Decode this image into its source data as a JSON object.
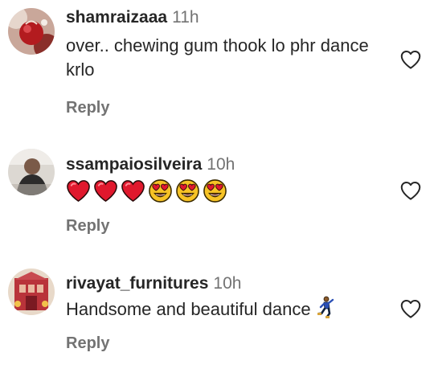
{
  "comments": [
    {
      "username": "shamraizaaa",
      "time": "11h",
      "text": "over.. chewing gum thook lo phr dance krlo",
      "reply_label": "Reply",
      "avatar_icon": "profile-photo-red-ornament",
      "like_icon": "heart-outline-icon"
    },
    {
      "username": "ssampaiosilveira",
      "time": "10h",
      "emojis": [
        "red-heart",
        "red-heart",
        "red-heart",
        "heart-eyes",
        "heart-eyes",
        "heart-eyes"
      ],
      "reply_label": "Reply",
      "avatar_icon": "profile-photo-person",
      "like_icon": "heart-outline-icon"
    },
    {
      "username": "rivayat_furnitures",
      "time": "10h",
      "text": "Handsome and beautiful dance",
      "trailing_emoji": "man-dancing",
      "reply_label": "Reply",
      "avatar_icon": "profile-photo-shop",
      "like_icon": "heart-outline-icon"
    }
  ],
  "colors": {
    "primary_text": "#262626",
    "secondary_text": "#737373",
    "heart_red": "#e0182d",
    "emoji_yellow": "#f7c325"
  }
}
